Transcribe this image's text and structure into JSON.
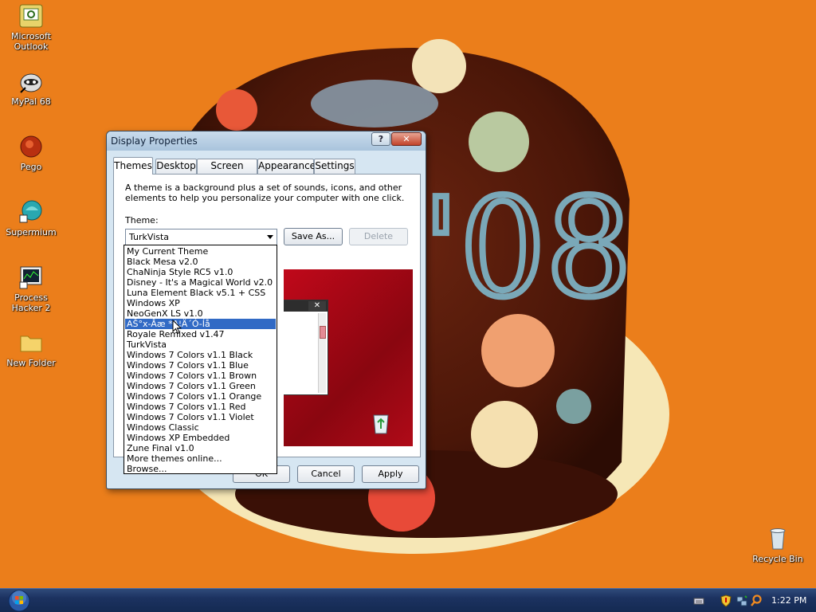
{
  "desktop": {
    "icons": [
      {
        "label": "Microsoft Outlook",
        "line1": "Microsoft",
        "line2": "Outlook",
        "icon": "outlook-icon"
      },
      {
        "label": "MyPal 68",
        "icon": "mypal-icon"
      },
      {
        "label": "Pego",
        "icon": "pego-icon"
      },
      {
        "label": "Supermium",
        "icon": "supermium-icon"
      },
      {
        "label": "Process Hacker 2",
        "line1": "Process",
        "line2": "Hacker 2",
        "icon": "process-hacker-icon"
      },
      {
        "label": "New Folder",
        "icon": "folder-icon"
      },
      {
        "label": "Recycle Bin",
        "icon": "recycle-bin-icon"
      }
    ],
    "wallpaper_text": "'08"
  },
  "dialog": {
    "title": "Display Properties",
    "help_button": "?",
    "close_button": "✕",
    "tabs": [
      "Themes",
      "Desktop",
      "Screen Saver",
      "Appearance",
      "Settings"
    ],
    "active_tab": "Themes",
    "description": "A theme is a background plus a set of sounds, icons, and other elements to help you personalize your computer with one click.",
    "theme_label": "Theme:",
    "theme_value": "TurkVista",
    "save_as_button": "Save As...",
    "delete_button": "Delete",
    "ok_button": "OK",
    "cancel_button": "Cancel",
    "apply_button": "Apply",
    "dropdown_items": [
      "My Current Theme",
      "Black Mesa v2.0",
      "ChaNinja Style RC5 v1.0",
      "Disney - It's a Magical World v2.0",
      "Luna Element Black v5.1 + CSS",
      "Windows XP",
      "NeoGenX LS v1.0",
      "AŠ°x-Âæ *A¦Ä´Ó-Íå",
      "Royale Remixed v1.47",
      "TurkVista",
      "Windows 7 Colors v1.1 Black",
      "Windows 7 Colors v1.1 Blue",
      "Windows 7 Colors v1.1 Brown",
      "Windows 7 Colors v1.1 Green",
      "Windows 7 Colors v1.1 Orange",
      "Windows 7 Colors v1.1 Red",
      "Windows 7 Colors v1.1 Violet",
      "Windows Classic",
      "Windows XP Embedded",
      "Zune Final v1.0",
      "More themes online...",
      "Browse..."
    ],
    "highlighted_item": "AŠ°x-Âæ *A¦Ä´Ó-Íå",
    "preview_close": "✕"
  },
  "taskbar": {
    "start_icon": "windows-orb-icon",
    "clock": "1:22 PM",
    "tray_icons": [
      "keyboard-icon",
      "shield-icon",
      "network-icon",
      "search-icon"
    ]
  },
  "colors": {
    "selection": "#316ac5",
    "taskbar": "#1c3260",
    "wallpaper_orange": "#e86f10"
  }
}
